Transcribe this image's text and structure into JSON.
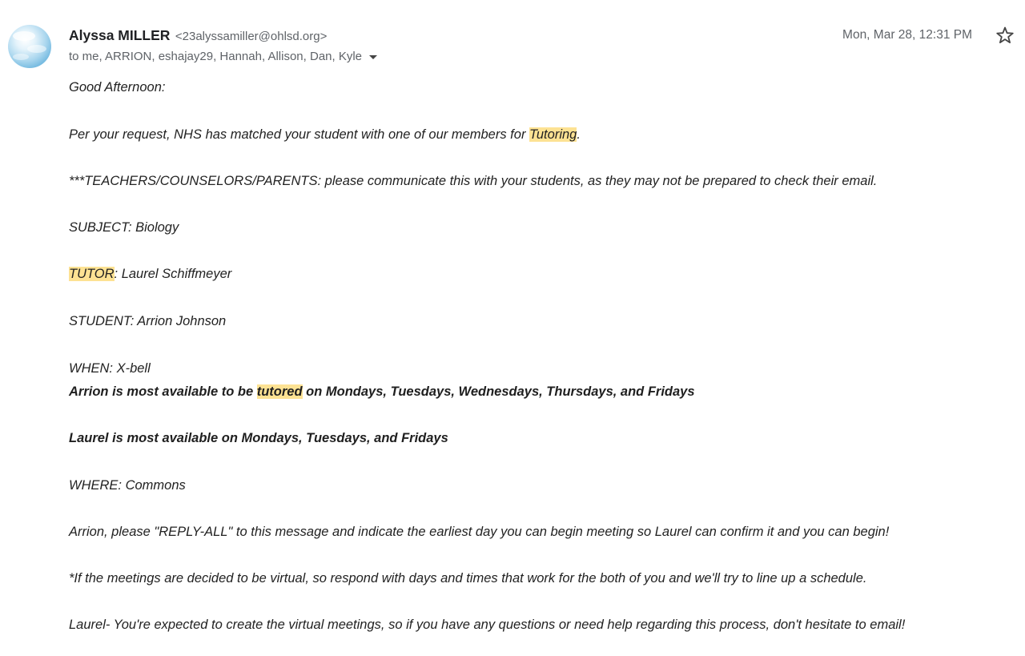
{
  "sender": {
    "name": "Alyssa MILLER",
    "email": "<23alyssamiller@ohlsd.org>"
  },
  "recipients": "to me, ARRION, eshajay29, Hannah, Allison, Dan, Kyle",
  "date": "Mon, Mar 28, 12:31 PM",
  "icons": {
    "star": "star-outline-icon",
    "avatar": "sender-avatar",
    "caret": "chevron-down-icon"
  },
  "colors": {
    "highlight": "#fde293",
    "meta_text": "#5f6368"
  },
  "body": {
    "greeting": "Good Afternoon:",
    "request_pre": "Per your request, NHS has matched your student with one of our members for ",
    "request_hl": "Tutoring",
    "request_post": ".",
    "teachers_note": "***TEACHERS/COUNSELORS/PARENTS: please communicate this with your students, as they may not be prepared to check their email.",
    "subject": "SUBJECT: Biology",
    "tutor_hl": "TUTOR",
    "tutor_post": ": Laurel Schiffmeyer",
    "student": "STUDENT: Arrion Johnson",
    "when": "WHEN: X-bell",
    "arrion_pre": "Arrion is most available to be ",
    "arrion_hl": "tutored",
    "arrion_post": " on Mondays, Tuesdays, Wednesdays, Thursdays, and Fridays",
    "laurel_avail": "Laurel is most available on Mondays, Tuesdays, and Fridays",
    "where": "WHERE: Commons",
    "reply_all": "Arrion, please \"REPLY-ALL\" to this message and indicate the earliest day you can begin meeting so Laurel can confirm it and you can begin!",
    "virtual": "*If the meetings are decided to be virtual, so respond with days and times that work for the both of you and we'll try to line up a schedule.",
    "laurel_note": "Laurel- You're expected to create the virtual meetings, so if you have any questions or need help regarding this process, don't hesitate to email!"
  }
}
